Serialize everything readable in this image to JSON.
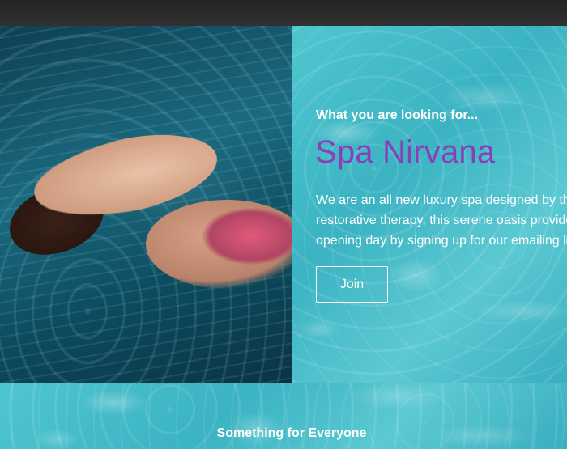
{
  "hero": {
    "eyebrow": "What you are looking for...",
    "title": "Spa Nirvana",
    "title_color": "#8a3fb8",
    "description_lines": [
      "We are an all new luxury spa designed by th",
      "restorative therapy, this serene oasis provide",
      "opening day by signing up for our emailing li"
    ],
    "join_label": "Join",
    "photo": "woman-floating-in-pool-photo"
  },
  "section2": {
    "title": "Something for Everyone"
  }
}
